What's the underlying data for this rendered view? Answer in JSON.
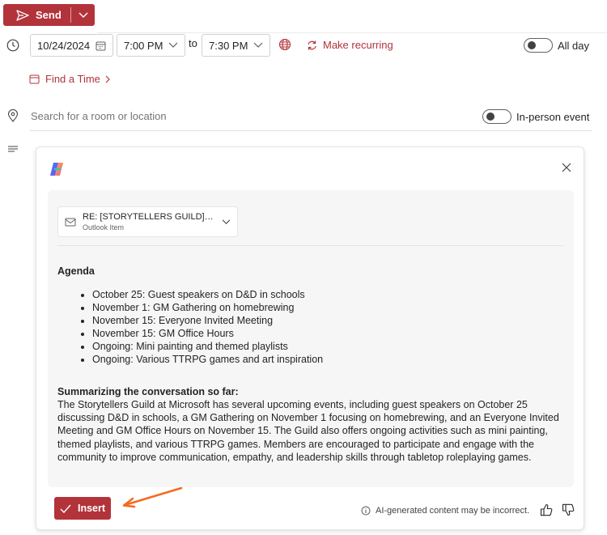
{
  "toolbar": {
    "send_label": "Send"
  },
  "schedule": {
    "date": "10/24/2024",
    "start_time": "7:00 PM",
    "to_label": "to",
    "end_time": "7:30 PM",
    "make_recurring": "Make recurring",
    "all_day_label": "All day",
    "find_time": "Find a Time"
  },
  "location": {
    "placeholder": "Search for a room or location",
    "in_person_label": "In-person event"
  },
  "copilot": {
    "reference": {
      "title": "RE: [STORYTELLERS GUILD] Del...",
      "subtitle": "Outlook Item"
    },
    "agenda_heading": "Agenda",
    "agenda_items": [
      "October 25: Guest speakers on D&D in schools",
      "November 1: GM Gathering on homebrewing",
      "November 15: Everyone Invited Meeting",
      "November 15: GM Office Hours",
      "Ongoing: Mini painting and themed playlists",
      "Ongoing: Various TTRPG games and art inspiration"
    ],
    "summary_heading": "Summarizing the conversation so far:",
    "summary_text": "The Storytellers Guild at Microsoft has several upcoming events, including guest speakers on October 25 discussing D&D in schools, a GM Gathering on November 1 focusing on homebrewing, and an Everyone Invited Meeting and GM Office Hours on November 15. The Guild also offers ongoing activities such as mini painting, themed playlists, and various TTRPG games. Members are encouraged to participate and engage with the community to improve communication, empathy, and leadership skills through tabletop roleplaying games.",
    "insert_label": "Insert",
    "disclaimer": "AI-generated content may be incorrect."
  },
  "colors": {
    "accent": "#b3333a",
    "annotation_arrow": "#f26b21"
  }
}
